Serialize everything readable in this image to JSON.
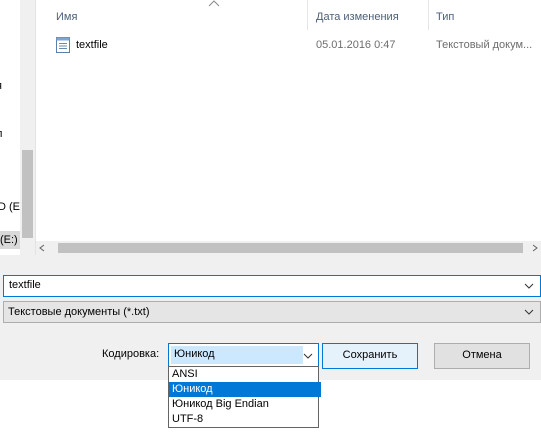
{
  "nav": {
    "items": [
      {
        "label": "я",
        "selected": false
      },
      {
        "label": "л",
        "selected": false
      },
      {
        "label": "D (E",
        "selected": false
      },
      {
        "label": "(E:)",
        "selected": true
      }
    ]
  },
  "columns": {
    "name": "Имя",
    "date": "Дата изменения",
    "type": "Тип"
  },
  "files": [
    {
      "name": "textfile",
      "date": "05.01.2016 0:47",
      "type": "Текстовый докум...",
      "icon": "text-file-icon"
    }
  ],
  "filename": {
    "value": "textfile"
  },
  "filetype": {
    "value": "Текстовые документы (*.txt)"
  },
  "encoding": {
    "label": "Кодировка:",
    "selected": "Юникод",
    "options": [
      "ANSI",
      "Юникод",
      "Юникод Big Endian",
      "UTF-8"
    ],
    "highlighted_index": 1
  },
  "buttons": {
    "save": "Сохранить",
    "cancel": "Отмена"
  },
  "colors": {
    "accent": "#0078d7",
    "header_text": "#4c607a",
    "selection_bg": "#cce8ff"
  }
}
